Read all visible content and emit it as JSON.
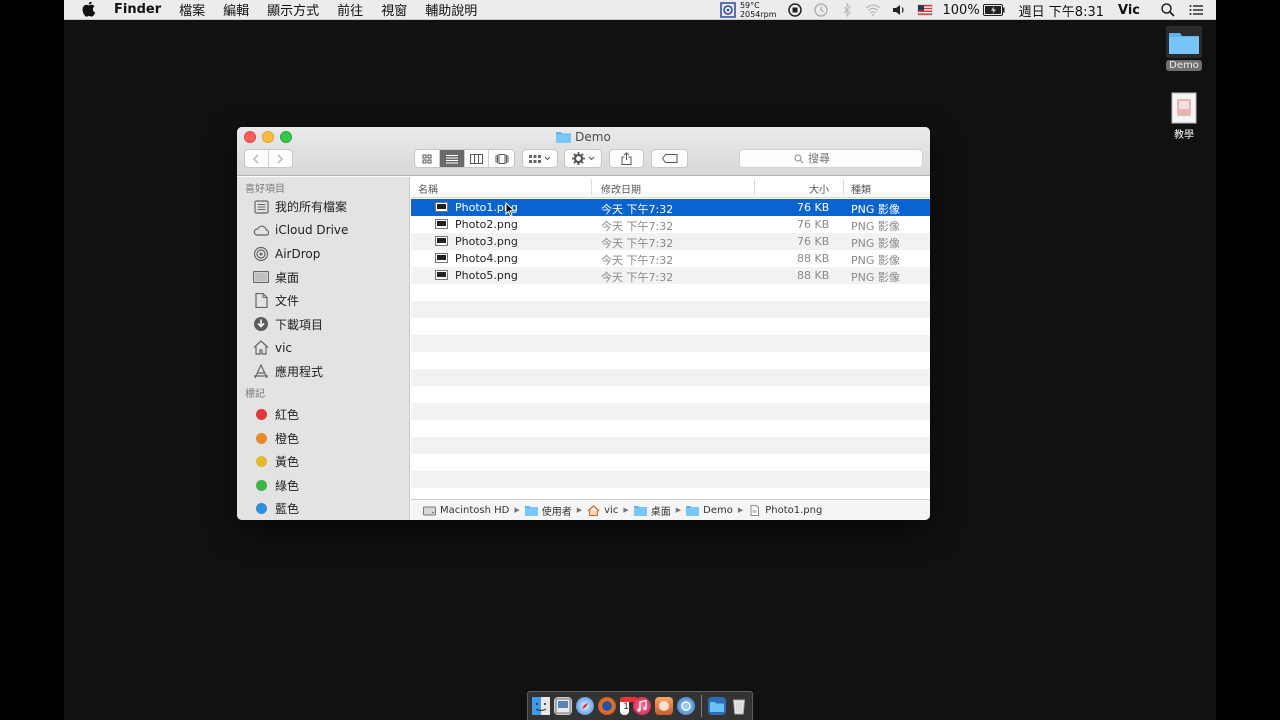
{
  "menubar": {
    "app_name": "Finder",
    "menus": [
      "檔案",
      "編輯",
      "顯示方式",
      "前往",
      "視窗",
      "輔助說明"
    ],
    "temp": "59°C",
    "rpm": "2054rpm",
    "battery": "100%",
    "clock": "週日 下午8:31",
    "user": "Vic"
  },
  "desktop": {
    "icons": [
      {
        "label": "Demo"
      },
      {
        "label": "教學"
      }
    ]
  },
  "window": {
    "title": "Demo",
    "search_placeholder": "搜尋",
    "sidebar": {
      "favorites_heading": "喜好項目",
      "favorites": [
        {
          "label": "我的所有檔案",
          "icon": "all-files-icon"
        },
        {
          "label": "iCloud Drive",
          "icon": "cloud-icon"
        },
        {
          "label": "AirDrop",
          "icon": "airdrop-icon"
        },
        {
          "label": "桌面",
          "icon": "desktop-icon"
        },
        {
          "label": "文件",
          "icon": "documents-icon"
        },
        {
          "label": "下載項目",
          "icon": "downloads-icon"
        },
        {
          "label": "vic",
          "icon": "home-icon"
        },
        {
          "label": "應用程式",
          "icon": "applications-icon"
        }
      ],
      "tags_heading": "標記",
      "tags": [
        {
          "label": "紅色",
          "color": "#e0383e"
        },
        {
          "label": "橙色",
          "color": "#e78a2f"
        },
        {
          "label": "黃色",
          "color": "#e3b92b"
        },
        {
          "label": "綠色",
          "color": "#3bb54a"
        },
        {
          "label": "藍色",
          "color": "#2b8fde"
        }
      ]
    },
    "columns": {
      "name": "名稱",
      "modified": "修改日期",
      "size": "大小",
      "kind": "種類"
    },
    "files": [
      {
        "name": "Photo1.png",
        "modified": "今天 下午7:32",
        "size": "76 KB",
        "kind": "PNG 影像",
        "selected": true
      },
      {
        "name": "Photo2.png",
        "modified": "今天 下午7:32",
        "size": "76 KB",
        "kind": "PNG 影像",
        "selected": false
      },
      {
        "name": "Photo3.png",
        "modified": "今天 下午7:32",
        "size": "76 KB",
        "kind": "PNG 影像",
        "selected": false
      },
      {
        "name": "Photo4.png",
        "modified": "今天 下午7:32",
        "size": "88 KB",
        "kind": "PNG 影像",
        "selected": false
      },
      {
        "name": "Photo5.png",
        "modified": "今天 下午7:32",
        "size": "88 KB",
        "kind": "PNG 影像",
        "selected": false
      }
    ],
    "pathbar": [
      {
        "label": "Macintosh HD",
        "icon": "hard-drive-icon"
      },
      {
        "label": "使用者",
        "icon": "folder-icon"
      },
      {
        "label": "vic",
        "icon": "home-icon"
      },
      {
        "label": "桌面",
        "icon": "folder-icon"
      },
      {
        "label": "Demo",
        "icon": "folder-icon"
      },
      {
        "label": "Photo1.png",
        "icon": "file-icon"
      }
    ]
  },
  "dock": {
    "calendar_day": "19"
  }
}
